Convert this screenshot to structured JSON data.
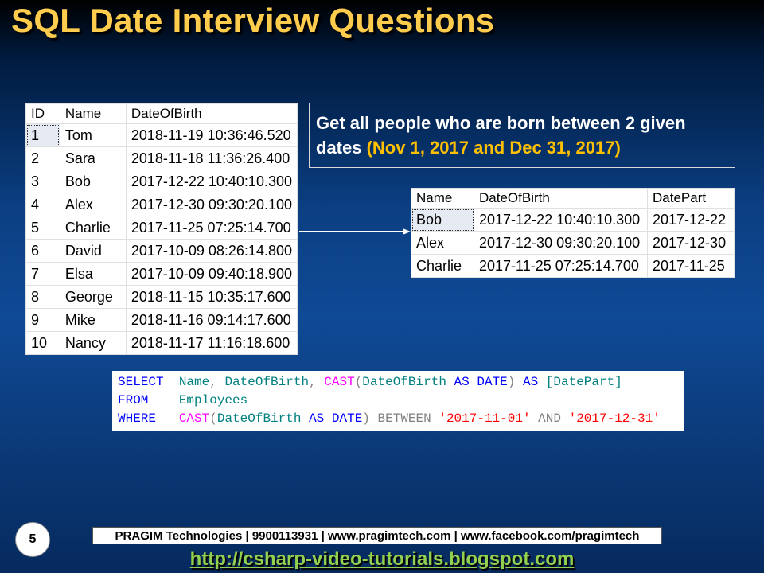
{
  "slide": {
    "title": "SQL Date Interview Questions",
    "number": "5"
  },
  "source_table": {
    "headers": [
      "ID",
      "Name",
      "DateOfBirth"
    ],
    "rows": [
      [
        "1",
        "Tom",
        "2018-11-19 10:36:46.520"
      ],
      [
        "2",
        "Sara",
        "2018-11-18 11:36:26.400"
      ],
      [
        "3",
        "Bob",
        "2017-12-22 10:40:10.300"
      ],
      [
        "4",
        "Alex",
        "2017-12-30 09:30:20.100"
      ],
      [
        "5",
        "Charlie",
        "2017-11-25 07:25:14.700"
      ],
      [
        "6",
        "David",
        "2017-10-09 08:26:14.800"
      ],
      [
        "7",
        "Elsa",
        "2017-10-09 09:40:18.900"
      ],
      [
        "8",
        "George",
        "2018-11-15 10:35:17.600"
      ],
      [
        "9",
        "Mike",
        "2018-11-16 09:14:17.600"
      ],
      [
        "10",
        "Nancy",
        "2018-11-17 11:16:18.600"
      ]
    ]
  },
  "callout": {
    "text": "Get all people who are born between 2 given dates ",
    "highlight": "(Nov 1, 2017 and Dec 31, 2017)"
  },
  "result_table": {
    "headers": [
      "Name",
      "DateOfBirth",
      "DatePart"
    ],
    "rows": [
      [
        "Bob",
        "2017-12-22 10:40:10.300",
        "2017-12-22"
      ],
      [
        "Alex",
        "2017-12-30 09:30:20.100",
        "2017-12-30"
      ],
      [
        "Charlie",
        "2017-11-25 07:25:14.700",
        "2017-11-25"
      ]
    ]
  },
  "sql": {
    "kw_select": "SELECT",
    "col_name": "Name",
    "comma1": ",",
    "col_dob": "DateOfBirth",
    "comma2": ",",
    "fn_cast": "CAST",
    "paren_open": "(",
    "col_dob2": "DateOfBirth",
    "kw_as": "AS",
    "kw_date": "DATE",
    "paren_close": ")",
    "kw_as2": "AS",
    "alias": "[DatePart]",
    "kw_from": "FROM",
    "table": "Employees",
    "kw_where": "WHERE",
    "fn_cast2": "CAST",
    "paren_open2": "(",
    "col_dob3": "DateOfBirth",
    "kw_as3": "AS",
    "kw_date2": "DATE",
    "paren_close2": ")",
    "op_between": "BETWEEN",
    "str_from": "'2017-11-01'",
    "op_and": "AND",
    "str_to": "'2017-12-31'"
  },
  "footer": {
    "text": "PRAGIM Technologies | 9900113931 | www.pragimtech.com | www.facebook.com/pragimtech",
    "url": "http://csharp-video-tutorials.blogspot.com"
  },
  "colors": {
    "title": "#ffcc4d",
    "highlight": "#ffc000",
    "url": "#92d050"
  }
}
